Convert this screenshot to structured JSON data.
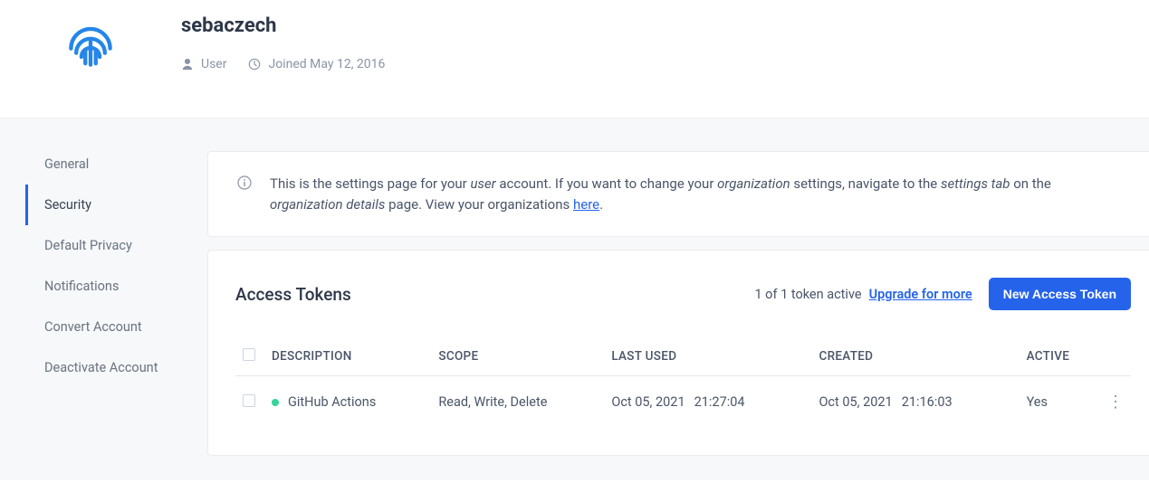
{
  "profile": {
    "username": "sebaczech",
    "role_label": "User",
    "joined_label": "Joined May 12, 2016"
  },
  "sidebar": {
    "items": [
      {
        "label": "General",
        "active": false
      },
      {
        "label": "Security",
        "active": true
      },
      {
        "label": "Default Privacy",
        "active": false
      },
      {
        "label": "Notifications",
        "active": false
      },
      {
        "label": "Convert Account",
        "active": false
      },
      {
        "label": "Deactivate Account",
        "active": false
      }
    ]
  },
  "info_banner": {
    "text_1": "This is the settings page for your ",
    "em_1": "user",
    "text_2": " account. If you want to change your ",
    "em_2": "organization",
    "text_3": " settings, navigate to the ",
    "em_3": "settings tab",
    "text_4": " on the ",
    "em_4": "organization details",
    "text_5": " page. View your organizations ",
    "link_text": "here",
    "text_6": "."
  },
  "tokens": {
    "title": "Access Tokens",
    "count_text": "1 of 1 token active",
    "upgrade_text": "Upgrade for more",
    "new_button": "New Access Token",
    "columns": {
      "description": "DESCRIPTION",
      "scope": "SCOPE",
      "last_used": "LAST USED",
      "created": "CREATED",
      "active": "ACTIVE"
    },
    "rows": [
      {
        "description": "GitHub Actions",
        "scope": "Read, Write, Delete",
        "last_used_date": "Oct 05, 2021",
        "last_used_time": "21:27:04",
        "created_date": "Oct 05, 2021",
        "created_time": "21:16:03",
        "active": "Yes",
        "status_color": "#34d399"
      }
    ]
  }
}
